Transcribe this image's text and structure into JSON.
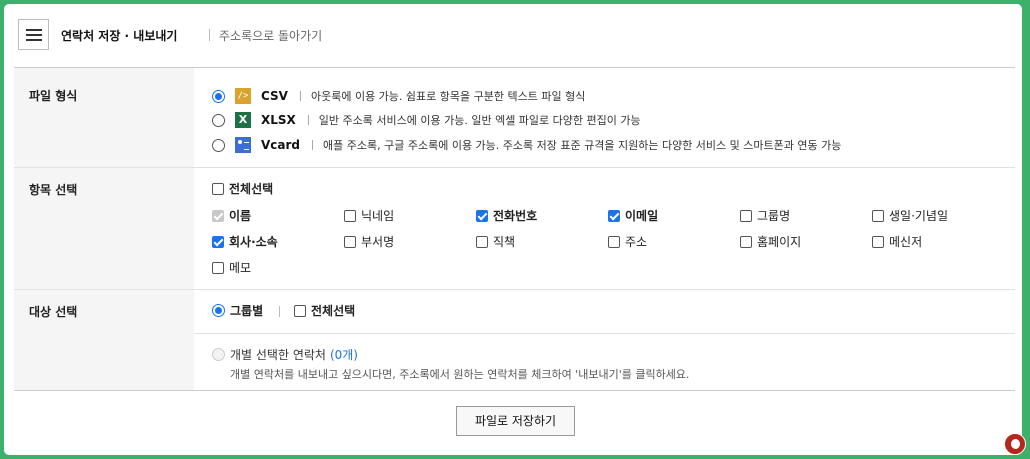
{
  "header": {
    "title": "연락처 저장 · 내보내기",
    "back_link": "주소록으로 돌아가기"
  },
  "file_format": {
    "label": "파일 형식",
    "options": [
      {
        "name": "CSV",
        "desc": "아웃룩에 이용 가능. 쉼표로 항목을 구분한 텍스트 파일 형식",
        "selected": true,
        "icon": "csv-file-icon",
        "icon_glyph": "/>"
      },
      {
        "name": "XLSX",
        "desc": "일반 주소록 서비스에 이용 가능. 일반 엑셀 파일로 다양한 편집이 가능",
        "selected": false,
        "icon": "excel-file-icon",
        "icon_glyph": "X"
      },
      {
        "name": "Vcard",
        "desc": "애플 주소록, 구글 주소록에 이용 가능. 주소록 저장 표준 규격을 지원하는 다양한 서비스 및 스마트폰과 연동 가능",
        "selected": false,
        "icon": "vcard-file-icon",
        "icon_glyph": ""
      }
    ]
  },
  "item_select": {
    "label": "항목 선택",
    "select_all": "전체선택",
    "items": [
      {
        "label": "이름",
        "checked": true,
        "disabled": true
      },
      {
        "label": "닉네임",
        "checked": false
      },
      {
        "label": "전화번호",
        "checked": true
      },
      {
        "label": "이메일",
        "checked": true
      },
      {
        "label": "그룹명",
        "checked": false
      },
      {
        "label": "생일·기념일",
        "checked": false
      },
      {
        "label": "회사·소속",
        "checked": true
      },
      {
        "label": "부서명",
        "checked": false
      },
      {
        "label": "직책",
        "checked": false
      },
      {
        "label": "주소",
        "checked": false
      },
      {
        "label": "홈페이지",
        "checked": false
      },
      {
        "label": "메신저",
        "checked": false
      },
      {
        "label": "메모",
        "checked": false
      }
    ]
  },
  "target_select": {
    "label": "대상 선택",
    "by_group": "그룹별",
    "select_all": "전체선택",
    "individual": "개별 선택한 연락처",
    "individual_count": "(0개)",
    "hint": "개별 연락처를 내보내고 싶으시다면, 주소록에서 원하는 연락처를 체크하여 '내보내기'를 클릭하세요."
  },
  "save_button": "파일로 저장하기",
  "colors": {
    "accent": "#1a73e8",
    "frame": "#3db06c",
    "header_bg": "#f5f5f5",
    "count": "#1a73e8"
  }
}
